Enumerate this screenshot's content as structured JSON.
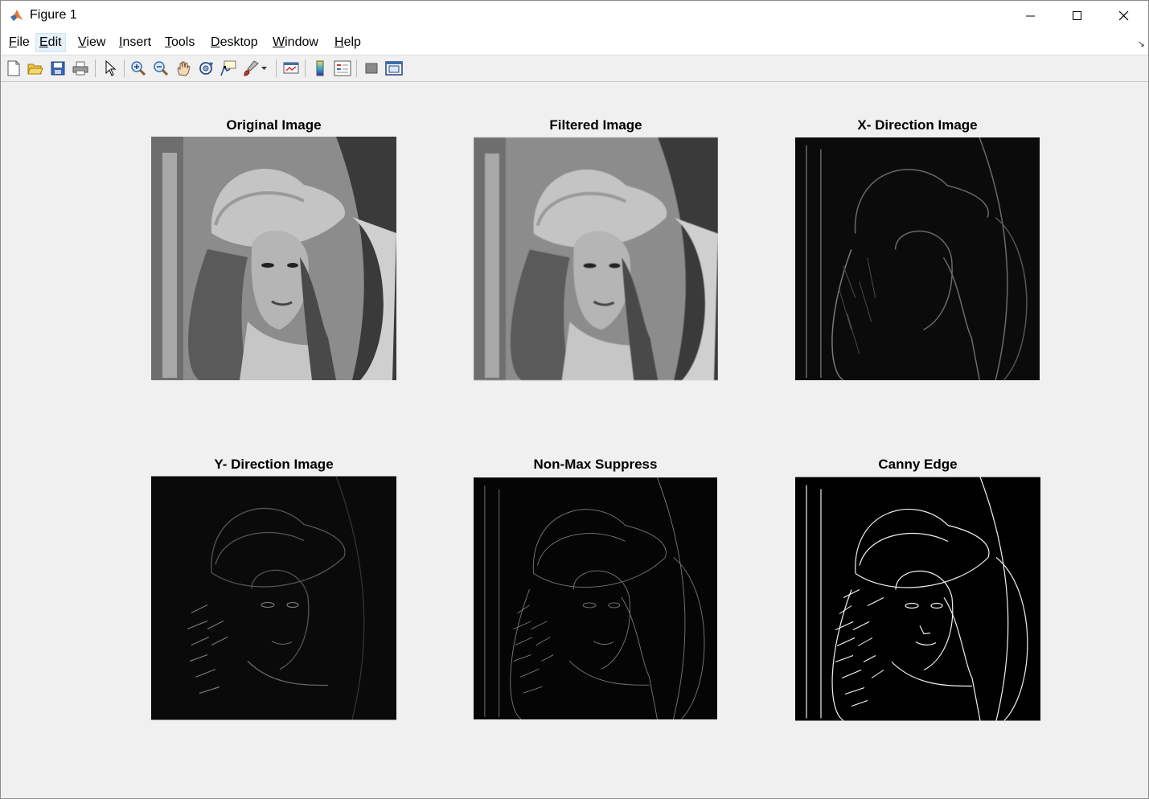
{
  "window": {
    "title": "Figure 1",
    "controls": [
      "minimize",
      "maximize",
      "close"
    ]
  },
  "menu": {
    "items": [
      {
        "label_pre": "",
        "accel": "F",
        "label_post": "ile"
      },
      {
        "label_pre": "",
        "accel": "E",
        "label_post": "dit"
      },
      {
        "label_pre": "",
        "accel": "V",
        "label_post": "iew"
      },
      {
        "label_pre": "",
        "accel": "I",
        "label_post": "nsert"
      },
      {
        "label_pre": "",
        "accel": "T",
        "label_post": "ools"
      },
      {
        "label_pre": "",
        "accel": "D",
        "label_post": "esktop"
      },
      {
        "label_pre": "",
        "accel": "W",
        "label_post": "indow"
      },
      {
        "label_pre": "",
        "accel": "H",
        "label_post": "elp"
      }
    ],
    "active_index": 1
  },
  "toolbar": {
    "icons": [
      "new-figure-icon",
      "open-file-icon",
      "save-icon",
      "print-icon",
      "edit-plot-arrow-icon",
      "zoom-in-icon",
      "zoom-out-icon",
      "pan-hand-icon",
      "rotate-3d-icon",
      "data-cursor-icon",
      "brush-icon",
      "brush-dropdown-icon",
      "link-plot-icon",
      "colorbar-icon",
      "legend-icon",
      "hide-plot-tools-icon",
      "show-plot-tools-icon"
    ]
  },
  "subplots": [
    {
      "title": "Original Image",
      "kind": "original"
    },
    {
      "title": "Filtered Image",
      "kind": "filtered"
    },
    {
      "title": "X- Direction Image",
      "kind": "xgrad"
    },
    {
      "title": "Y- Direction Image",
      "kind": "ygrad"
    },
    {
      "title": "Non-Max Suppress",
      "kind": "nms"
    },
    {
      "title": "Canny Edge",
      "kind": "canny"
    }
  ],
  "colors": {
    "background": "#f0f0f0",
    "titlebar": "#ffffff",
    "menu_active": "#e5f1fb"
  }
}
